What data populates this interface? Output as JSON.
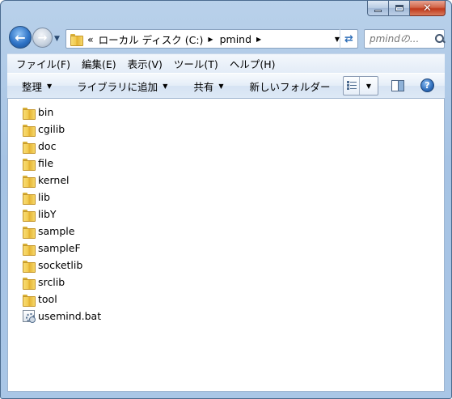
{
  "window": {
    "caption_buttons": {
      "minimize": "minimize-icon",
      "maximize": "maximize-icon",
      "close": "close-icon",
      "close_glyph": "✕"
    }
  },
  "nav": {
    "back_icon": "arrow-left-icon",
    "forward_icon": "arrow-right-icon",
    "address": {
      "overflow": "«",
      "crumbs": [
        "ローカル ディスク (C:)",
        "pmind"
      ]
    },
    "search": {
      "placeholder": "pmindの..."
    }
  },
  "menubar": {
    "items": [
      "ファイル(F)",
      "編集(E)",
      "表示(V)",
      "ツール(T)",
      "ヘルプ(H)"
    ]
  },
  "commandbar": {
    "organize": "整理",
    "add_to_library": "ライブラリに追加",
    "share": "共有",
    "new_folder": "新しいフォルダー",
    "help_glyph": "?"
  },
  "files": [
    {
      "name": "bin",
      "type": "folder"
    },
    {
      "name": "cgilib",
      "type": "folder"
    },
    {
      "name": "doc",
      "type": "folder"
    },
    {
      "name": "file",
      "type": "folder"
    },
    {
      "name": "kernel",
      "type": "folder"
    },
    {
      "name": "lib",
      "type": "folder"
    },
    {
      "name": "libY",
      "type": "folder"
    },
    {
      "name": "sample",
      "type": "folder"
    },
    {
      "name": "sampleF",
      "type": "folder"
    },
    {
      "name": "socketlib",
      "type": "folder"
    },
    {
      "name": "srclib",
      "type": "folder"
    },
    {
      "name": "tool",
      "type": "folder"
    },
    {
      "name": "usemind.bat",
      "type": "batch-file"
    }
  ]
}
